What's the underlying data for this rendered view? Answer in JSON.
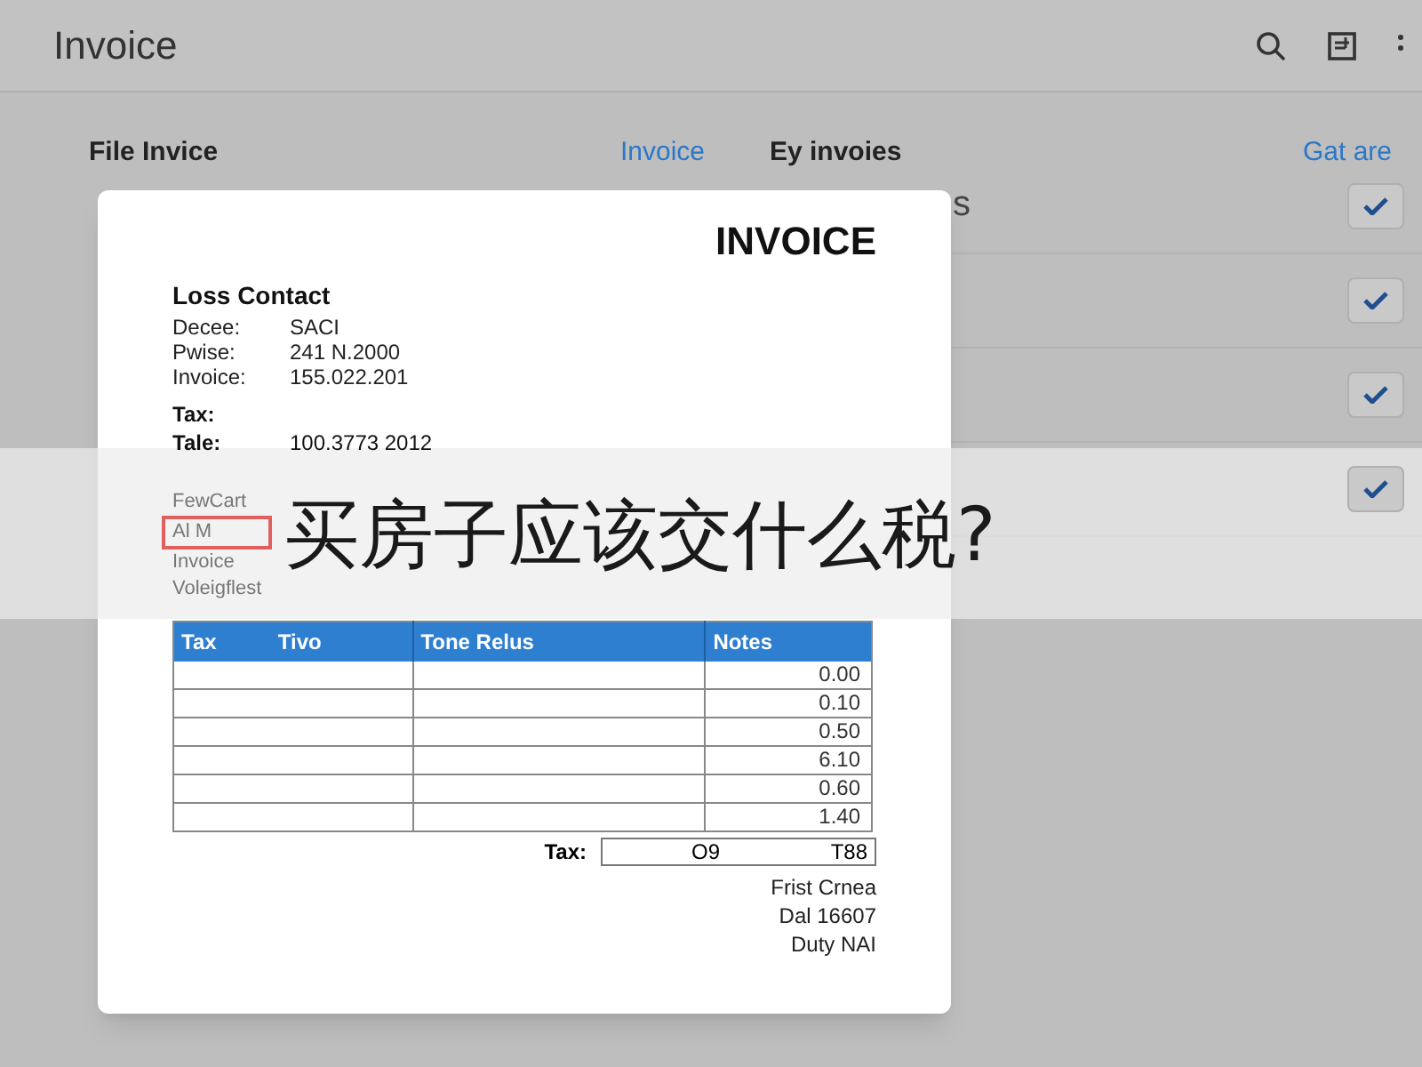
{
  "header": {
    "title": "Invoice"
  },
  "toolbar": {
    "items": [
      {
        "label": "File Invice",
        "kind": "plain"
      },
      {
        "label": "Invoice",
        "kind": "link"
      },
      {
        "label": "Ey invoies",
        "kind": "plain"
      },
      {
        "label": "Gat are",
        "kind": "link"
      }
    ]
  },
  "behind_text": "s",
  "checklist": [
    {
      "checked": true
    },
    {
      "checked": true
    },
    {
      "checked": true
    },
    {
      "checked": true
    }
  ],
  "invoice": {
    "title": "INVOICE",
    "contact_heading": "Loss Contact",
    "fields": [
      {
        "label": "Decee:",
        "value": "SACI"
      },
      {
        "label": "Pwise:",
        "value": "241 N.2000"
      },
      {
        "label": "Invoice:",
        "value": "155.022.201"
      }
    ],
    "tax_fields": [
      {
        "label": "Tax:"
      },
      {
        "label": "Tale:",
        "value": "100.3773 2012"
      }
    ],
    "faded_lines": [
      {
        "text": "FewCart",
        "highlighted": false
      },
      {
        "text": "Al M",
        "highlighted": true
      },
      {
        "text": "Invoice",
        "highlighted": false
      },
      {
        "text": "Voleigflest",
        "highlighted": false
      }
    ],
    "table": {
      "columns": [
        "Tax",
        "Tivo",
        "Tone Relus",
        "Notes"
      ],
      "rows": [
        "0.00",
        "0.10",
        "0.50",
        "6.10",
        "0.60",
        "1.40"
      ]
    },
    "tax_row": {
      "label": "Tax:",
      "value": "O9",
      "extra": "T88"
    },
    "footer": [
      "Frist Crnea",
      "Dal 16607",
      "Duty NAI"
    ]
  },
  "banner": {
    "text": "买房子应该交什么税?"
  }
}
